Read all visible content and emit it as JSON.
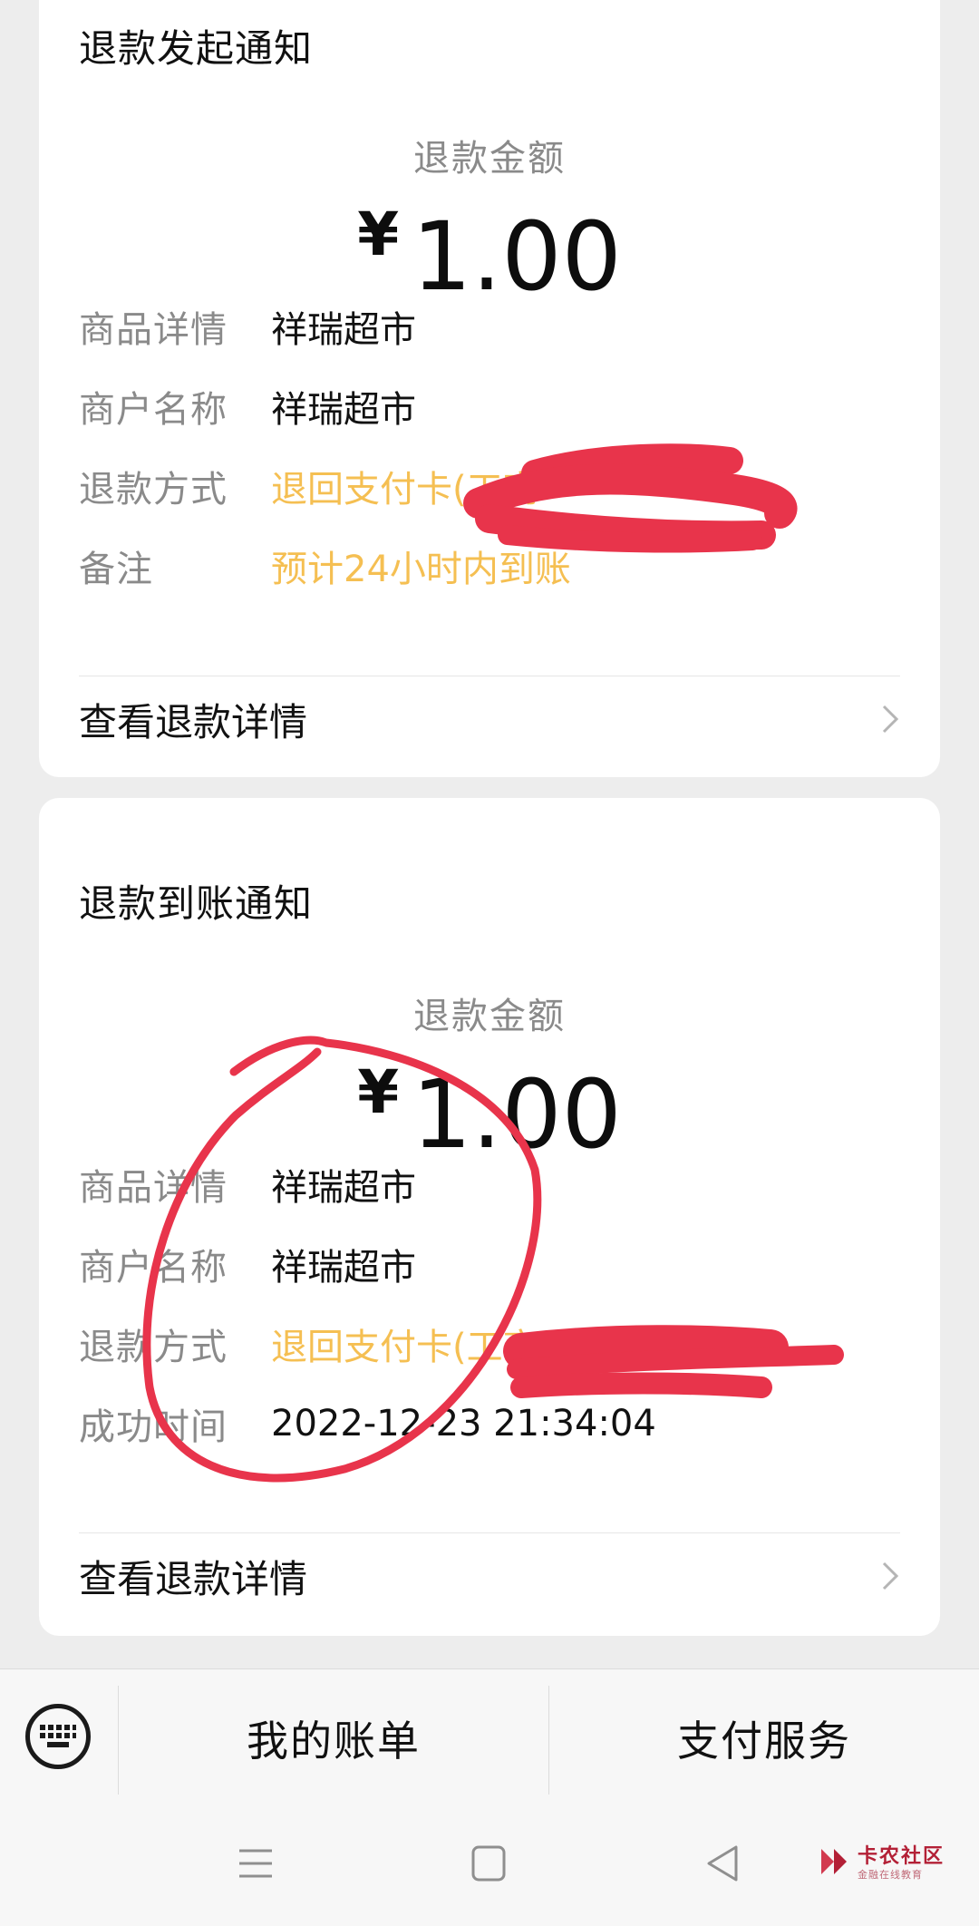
{
  "cards": [
    {
      "title": "退款发起通知",
      "amount_label": "退款金额",
      "currency": "¥",
      "amount": "1.00",
      "rows": [
        {
          "key": "商品详情",
          "value": "祥瑞超市"
        },
        {
          "key": "商户名称",
          "value": "祥瑞超市"
        },
        {
          "key": "退款方式",
          "value": "退回支付卡(工商"
        },
        {
          "key": "备注",
          "value": "预计24小时内到账"
        }
      ],
      "detail_link": "查看退款详情"
    },
    {
      "title": "退款到账通知",
      "amount_label": "退款金额",
      "currency": "¥",
      "amount": "1.00",
      "rows": [
        {
          "key": "商品详情",
          "value": "祥瑞超市"
        },
        {
          "key": "商户名称",
          "value": "祥瑞超市"
        },
        {
          "key": "退款方式",
          "value": "退回支付卡(工商"
        },
        {
          "key": "成功时间",
          "value": "2022-12-23 21:34:04"
        }
      ],
      "detail_link": "查看退款详情"
    }
  ],
  "bottom_menu": {
    "keyboard_icon": "keyboard-icon",
    "items": [
      "我的账单",
      "支付服务"
    ]
  },
  "system_nav": {
    "icons": [
      "menu-icon",
      "home-icon",
      "back-icon"
    ]
  },
  "watermark": {
    "title": "卡农社区",
    "subtitle": "金融在线教育"
  },
  "colors": {
    "background": "#ededed",
    "accent_orange": "#f5bf52",
    "scribble_red": "#e8344b",
    "label_gray": "#8a8a8a"
  }
}
